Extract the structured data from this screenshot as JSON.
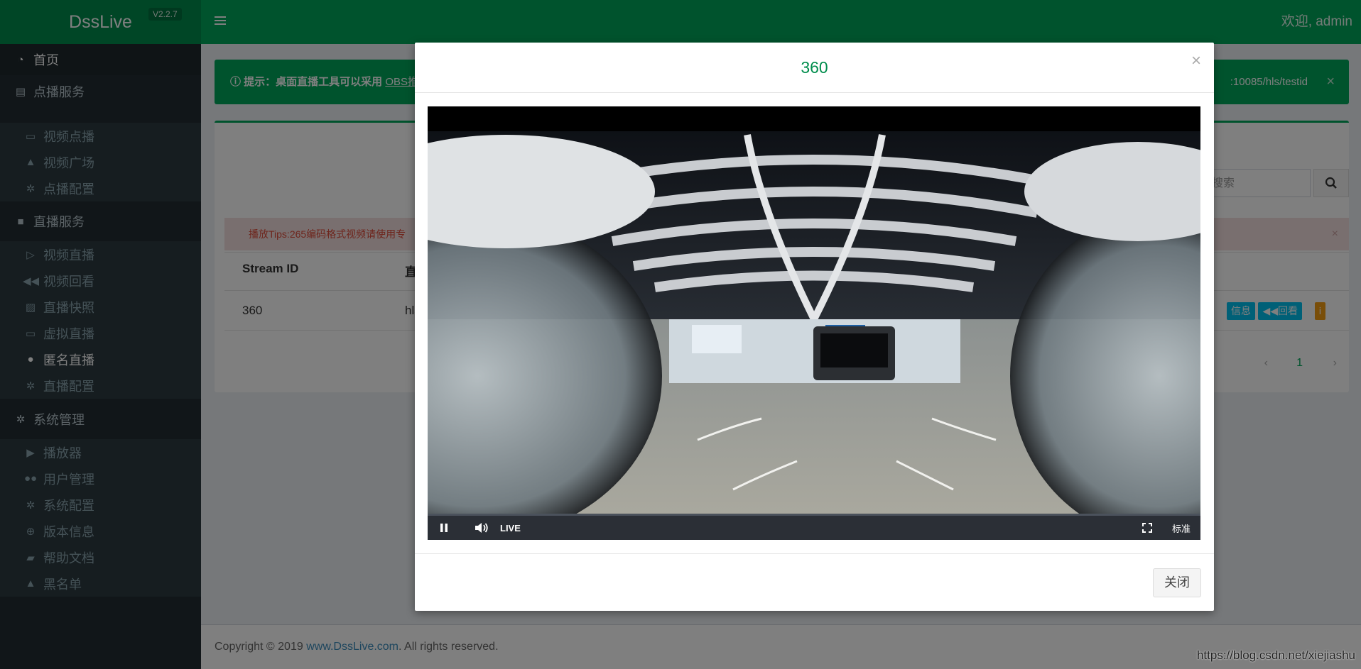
{
  "header": {
    "logo": "DssLive",
    "version": "V2.2.7",
    "welcome": "欢迎, admin"
  },
  "sidebar": {
    "items": [
      {
        "label": "首页",
        "icon": "dashboard-icon"
      },
      {
        "label": "点播服务",
        "icon": "film-icon"
      },
      {
        "label": "视频点播",
        "icon": "monitor-icon"
      },
      {
        "label": "视频广场",
        "icon": "road-icon"
      },
      {
        "label": "点播配置",
        "icon": "gear-icon"
      },
      {
        "label": "直播服务",
        "icon": "video-camera-icon"
      },
      {
        "label": "视频直播",
        "icon": "play-square-icon"
      },
      {
        "label": "视频回看",
        "icon": "backward-icon"
      },
      {
        "label": "直播快照",
        "icon": "image-icon"
      },
      {
        "label": "虚拟直播",
        "icon": "laptop-icon"
      },
      {
        "label": "匿名直播",
        "icon": "user-secret-icon"
      },
      {
        "label": "直播配置",
        "icon": "gear-icon"
      },
      {
        "label": "系统管理",
        "icon": "gears-icon"
      },
      {
        "label": "播放器",
        "icon": "play-circle-icon"
      },
      {
        "label": "用户管理",
        "icon": "users-icon"
      },
      {
        "label": "系统配置",
        "icon": "gear-icon"
      },
      {
        "label": "版本信息",
        "icon": "globe-icon"
      },
      {
        "label": "帮助文档",
        "icon": "book-icon"
      },
      {
        "label": "黑名单",
        "icon": "bell-icon"
      }
    ]
  },
  "content": {
    "alert_prefix": "提示：桌面直播工具可以采用 ",
    "alert_link": "OBS推",
    "alert_tail": ":10085/hls/testid",
    "search_placeholder": "搜索",
    "tips": "播放Tips:265编码格式视频请使用专",
    "table": {
      "headers": [
        "Stream ID",
        "直播"
      ],
      "rows": [
        [
          "360",
          "hls"
        ]
      ]
    },
    "op_buttons": [
      "信息",
      "回看",
      "i"
    ],
    "page_current": "1"
  },
  "footer": {
    "copyright_prefix": "Copyright © 2019 ",
    "copyright_link": "www.DssLive.com",
    "copyright_suffix": ". All rights reserved."
  },
  "modal": {
    "title": "360",
    "close_label": "关闭",
    "player": {
      "live_label": "LIVE",
      "quality_label": "标准"
    }
  },
  "watermark": "https://blog.csdn.net/xiejiashu",
  "colors": {
    "primary_green": "#00a65a",
    "dark_green": "#008d4c",
    "sidebar_bg": "#222d32",
    "link_blue": "#3c8dbc",
    "info_cyan": "#00c0ef",
    "warning_orange": "#f39c12"
  }
}
